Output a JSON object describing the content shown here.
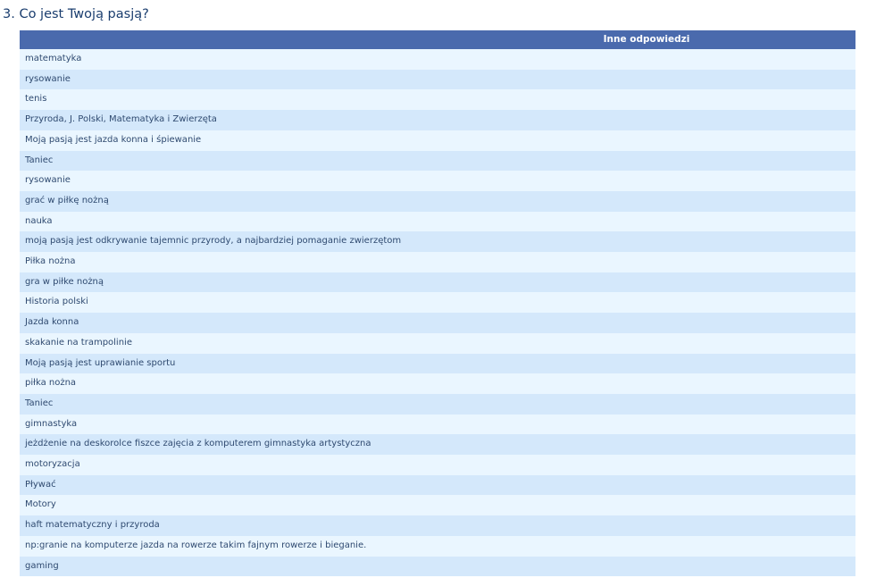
{
  "question": {
    "title": "3. Co jest Twoją pasją?"
  },
  "table": {
    "header": "Inne odpowiedzi",
    "rows": [
      "matematyka",
      "rysowanie",
      "tenis",
      "Przyroda, J. Polski, Matematyka i Zwierzęta",
      "Moją pasją jest jazda konna i śpiewanie",
      "Taniec",
      "rysowanie",
      "grać w piłkę nożną",
      "nauka",
      "moją pasją jest odkrywanie tajemnic przyrody, a najbardziej pomaganie zwierzętom",
      "Piłka nożna",
      "gra w piłke nożną",
      "Historia polski",
      "Jazda konna",
      "skakanie na trampolinie",
      "Moją pasją jest uprawianie sportu",
      "piłka nożna",
      "Taniec",
      "gimnastyka",
      "jeżdżenie na deskorolce fiszce zajęcia z komputerem gimnastyka artystyczna",
      "motoryzacja",
      "Pływać",
      "Motory",
      "haft matematyczny i przyroda",
      "np:granie na komputerze jazda na rowerze takim fajnym rowerze i bieganie.",
      "gaming"
    ]
  },
  "colors": {
    "header_bg": "#4a6aad",
    "row_odd_bg": "#eaf6ff",
    "row_even_bg": "#d4e8fb",
    "text": "#2f4a70",
    "title": "#1a3d6e"
  }
}
